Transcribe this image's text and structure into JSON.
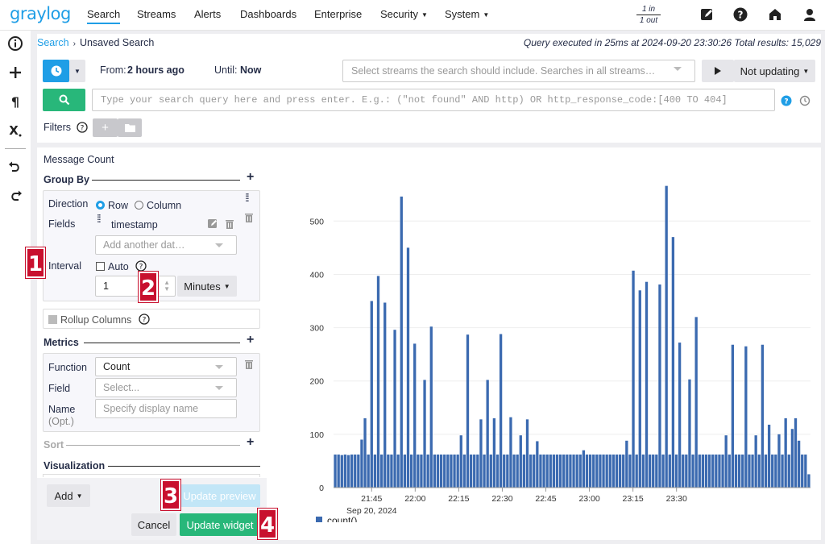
{
  "nav": {
    "logo": "graylog",
    "items": [
      {
        "label": "Search",
        "active": true,
        "caret": false
      },
      {
        "label": "Streams",
        "active": false,
        "caret": false
      },
      {
        "label": "Alerts",
        "active": false,
        "caret": false
      },
      {
        "label": "Dashboards",
        "active": false,
        "caret": false
      },
      {
        "label": "Enterprise",
        "active": false,
        "caret": false
      },
      {
        "label": "Security",
        "active": false,
        "caret": true
      },
      {
        "label": "System",
        "active": false,
        "caret": true
      }
    ],
    "throughput_in": "1 in",
    "throughput_out": "1 out",
    "icons": [
      "edit-icon",
      "help-icon",
      "home-icon",
      "user-icon"
    ]
  },
  "sidebar": {
    "icons": [
      "info-icon",
      "plus-icon",
      "paragraph-icon",
      "x-subscript-icon",
      "undo-icon",
      "redo-icon"
    ]
  },
  "search": {
    "breadcrumb_link": "Search",
    "breadcrumb_current": "Unsaved Search",
    "query_info": "Query executed in 25ms at 2024-09-20 23:30:26 Total results: 15,029",
    "from_label": "From:",
    "from_value": "2 hours ago",
    "until_label": "Until:",
    "until_value": "Now",
    "streams_placeholder": "Select streams the search should include. Searches in all streams…",
    "refresh_label": "Not updating",
    "query_placeholder": "Type your search query here and press enter. E.g.: (\"not found\" AND http) OR http_response_code:[400 TO 404]",
    "filters_label": "Filters"
  },
  "widget": {
    "title": "Message Count",
    "group_by": "Group By",
    "direction_label": "Direction",
    "direction_row": "Row",
    "direction_column": "Column",
    "fields_label": "Fields",
    "field_value": "timestamp",
    "add_another_placeholder": "Add another dat…",
    "interval_label": "Interval",
    "auto_label": "Auto",
    "interval_value": "1",
    "interval_unit": "Minutes",
    "rollup_label": "Rollup Columns",
    "metrics": "Metrics",
    "function_label": "Function",
    "function_value": "Count",
    "field_label": "Field",
    "field_placeholder": "Select...",
    "name_label": "Name",
    "name_opt": "(Opt.)",
    "name_placeholder": "Specify display name",
    "sort": "Sort",
    "visualization": "Visualization",
    "add_button": "Add",
    "update_preview": "Update preview",
    "cancel": "Cancel",
    "update_widget": "Update widget",
    "markers": [
      "1",
      "2",
      "3",
      "4"
    ]
  },
  "colors": {
    "accent": "#1f9ee6",
    "success": "#28b77a",
    "bar": "#3b6ab0",
    "marker": "#c8102e"
  },
  "chart_data": {
    "type": "bar",
    "x_ticks": [
      "21:45",
      "22:00",
      "22:15",
      "22:30",
      "22:45",
      "23:00",
      "23:15",
      "23:30"
    ],
    "x_subtick": "Sep 20, 2024",
    "y_ticks": [
      "0",
      "100",
      "200",
      "300",
      "400",
      "500"
    ],
    "ylim": [
      0,
      570
    ],
    "legend": "count()",
    "series": [
      {
        "name": "count()",
        "values": [
          62,
          62,
          61,
          62,
          61,
          62,
          62,
          62,
          90,
          130,
          62,
          350,
          62,
          397,
          62,
          347,
          62,
          62,
          296,
          62,
          546,
          62,
          450,
          62,
          270,
          62,
          62,
          202,
          62,
          302,
          62,
          62,
          62,
          62,
          62,
          62,
          62,
          62,
          98,
          62,
          287,
          62,
          62,
          62,
          128,
          62,
          202,
          62,
          130,
          62,
          288,
          62,
          62,
          132,
          62,
          62,
          98,
          62,
          128,
          62,
          62,
          87,
          62,
          62,
          62,
          62,
          62,
          62,
          62,
          62,
          62,
          62,
          62,
          62,
          62,
          70,
          62,
          62,
          62,
          62,
          62,
          62,
          62,
          62,
          62,
          62,
          62,
          62,
          88,
          62,
          407,
          62,
          370,
          62,
          386,
          62,
          62,
          62,
          381,
          62,
          566,
          62,
          470,
          62,
          272,
          62,
          62,
          203,
          62,
          320,
          62,
          62,
          62,
          62,
          62,
          62,
          62,
          62,
          98,
          62,
          268,
          62,
          62,
          62,
          265,
          62,
          62,
          98,
          62,
          268,
          62,
          118,
          62,
          62,
          100,
          62,
          130,
          62,
          110,
          130,
          88,
          62,
          62,
          25
        ]
      }
    ]
  }
}
